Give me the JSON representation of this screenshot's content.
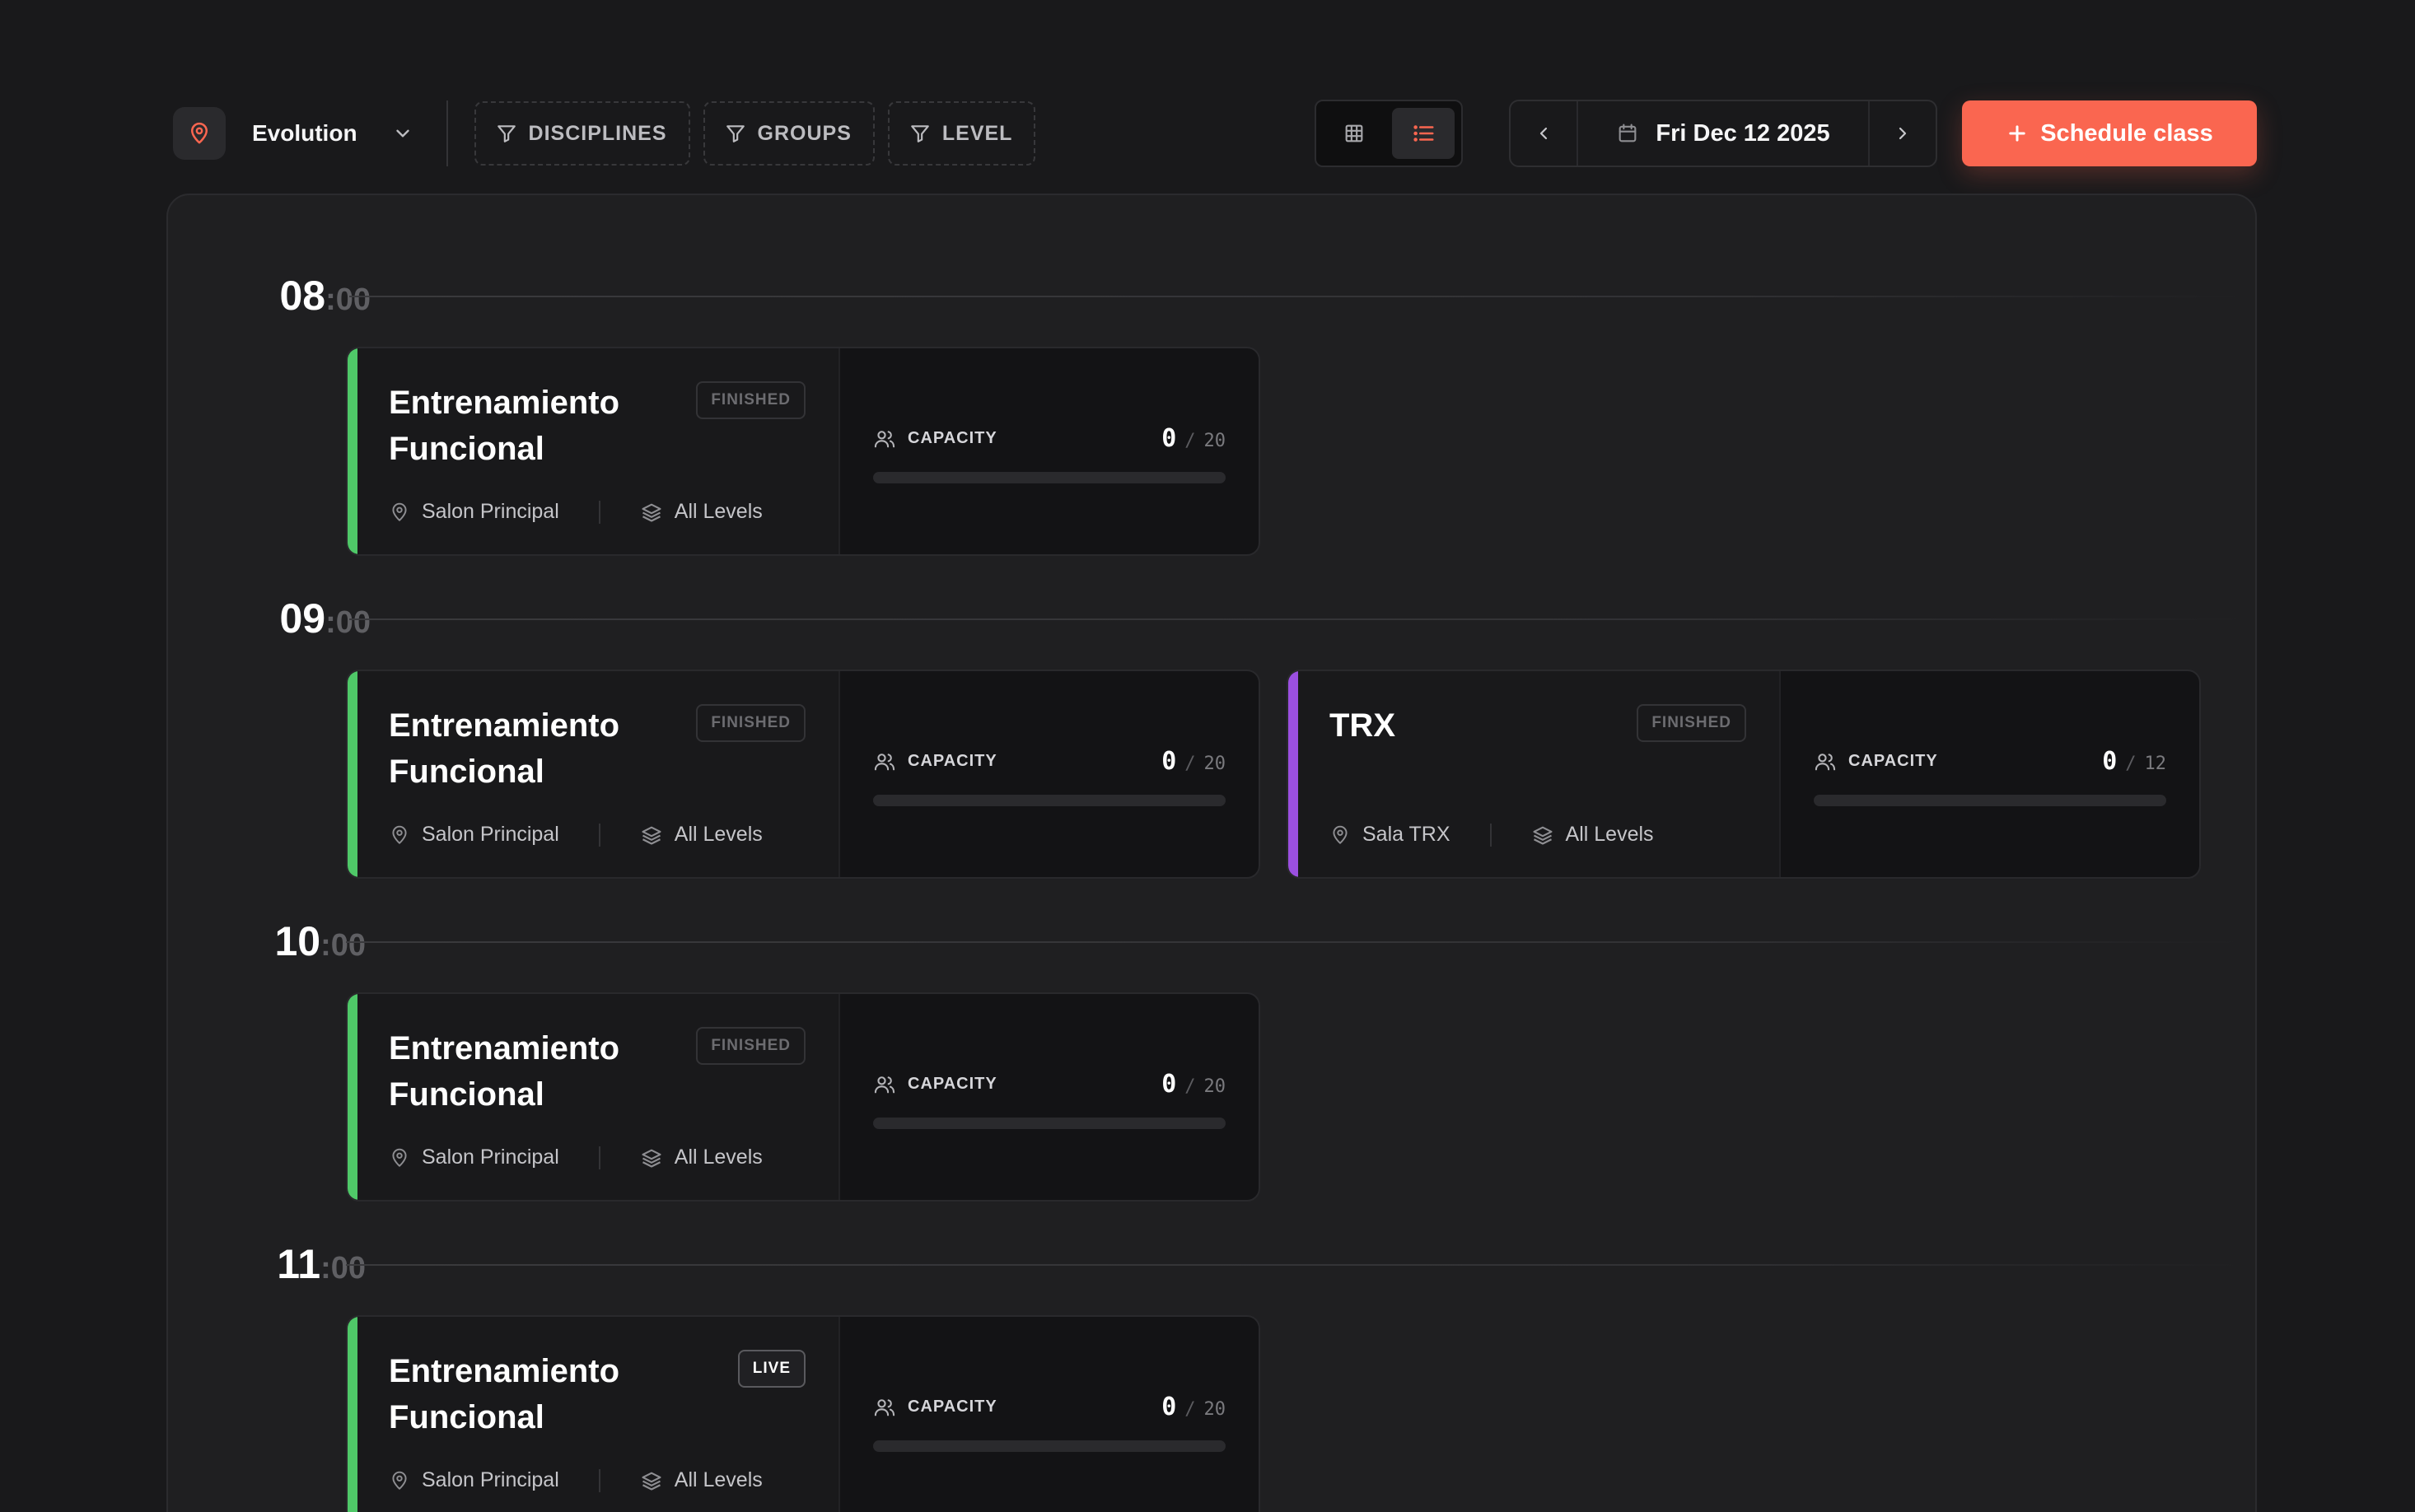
{
  "toolbar": {
    "location": "Evolution",
    "filters": [
      "DISCIPLINES",
      "GROUPS",
      "LEVEL"
    ],
    "date": "Fri Dec 12 2025",
    "schedule_label": "Schedule class"
  },
  "colors": {
    "accent": "#fa6650",
    "functional": "#4fc868",
    "trx": "#9b4fe0"
  },
  "hours": [
    {
      "hour": "08",
      "min": ":00"
    },
    {
      "hour": "09",
      "min": ":00"
    },
    {
      "hour": "10",
      "min": ":00"
    },
    {
      "hour": "11",
      "min": ":00"
    }
  ],
  "classes": [
    {
      "title": "Entrenamiento Funcional",
      "status": "FINISHED",
      "room": "Salon Principal",
      "level": "All Levels",
      "capacity_label": "CAPACITY",
      "current": "0",
      "max": "20",
      "fill_fraction": 0
    },
    {
      "title": "Entrenamiento Funcional",
      "status": "FINISHED",
      "room": "Salon Principal",
      "level": "All Levels",
      "capacity_label": "CAPACITY",
      "current": "0",
      "max": "20",
      "fill_fraction": 0
    },
    {
      "title": "TRX",
      "status": "FINISHED",
      "room": "Sala TRX",
      "level": "All Levels",
      "capacity_label": "CAPACITY",
      "current": "0",
      "max": "12",
      "fill_fraction": 0
    },
    {
      "title": "Entrenamiento Funcional",
      "status": "FINISHED",
      "room": "Salon Principal",
      "level": "All Levels",
      "capacity_label": "CAPACITY",
      "current": "0",
      "max": "20",
      "fill_fraction": 0
    },
    {
      "title": "Entrenamiento Funcional",
      "status": "LIVE",
      "room": "Salon Principal",
      "level": "All Levels",
      "capacity_label": "CAPACITY",
      "current": "0",
      "max": "20",
      "fill_fraction": 0
    }
  ]
}
